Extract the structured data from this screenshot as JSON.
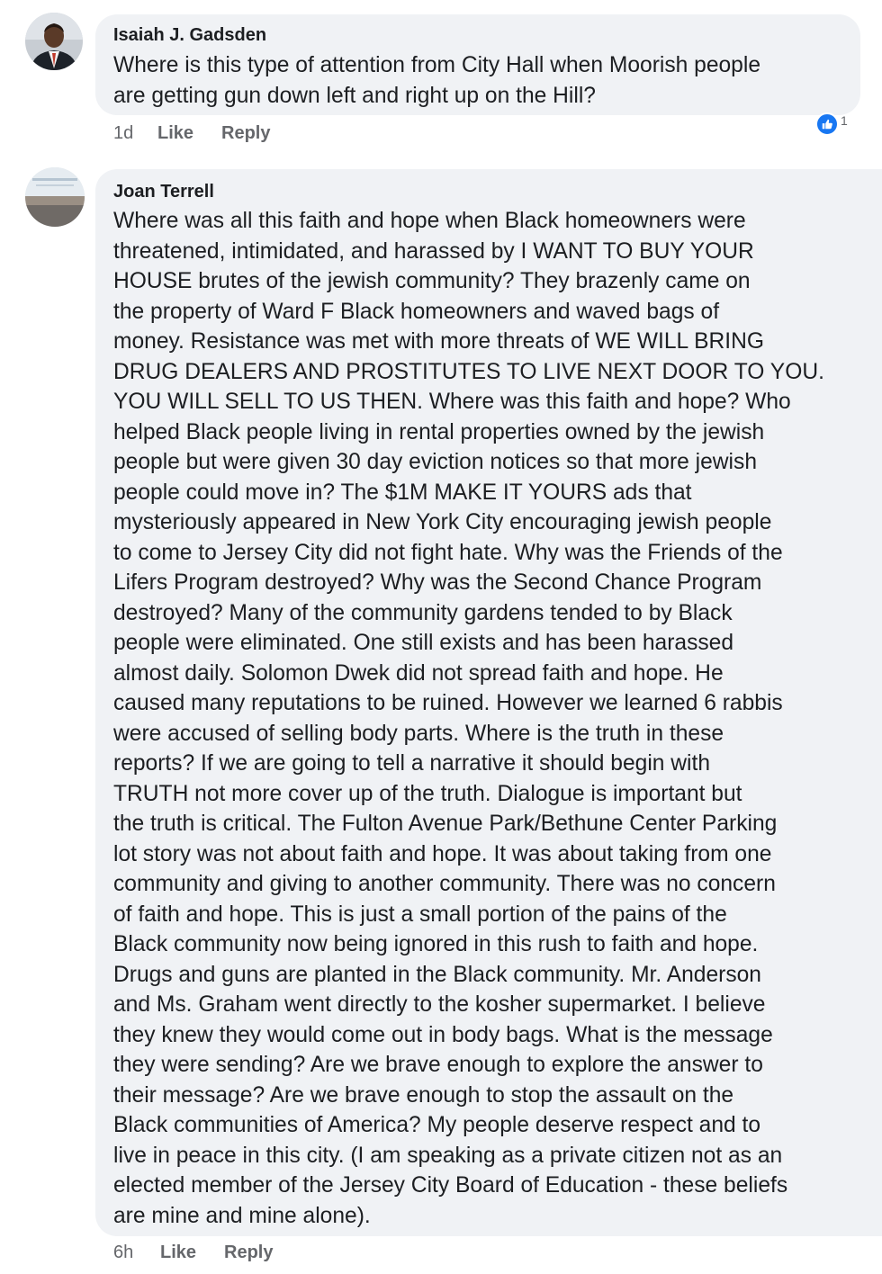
{
  "comments": [
    {
      "author": "Isaiah J. Gadsden",
      "text_lines": [
        "Where is this type of attention from City Hall when Moorish people",
        "are getting gun down left and right up on the Hill?"
      ],
      "time": "1d",
      "like_label": "Like",
      "reply_label": "Reply",
      "reaction_icon": "thumbs-up-icon",
      "reaction_count": "1"
    },
    {
      "author": "Joan Terrell",
      "text_lines": [
        "Where was all this faith and hope when Black homeowners were",
        "threatened, intimidated, and harassed by I WANT TO BUY YOUR",
        "HOUSE brutes of the jewish community?   They brazenly came on",
        "the property of Ward F Black homeowners and waved bags of",
        "money.  Resistance was met with more threats of WE WILL BRING",
        "DRUG DEALERS AND PROSTITUTES TO LIVE NEXT DOOR TO YOU.",
        "YOU WILL SELL TO US THEN.  Where was this faith and hope?   Who",
        "helped Black people living in rental properties owned by the jewish",
        "people but were given 30 day eviction notices so that more jewish",
        "people could move in?   The $1M MAKE IT YOURS ads that",
        "mysteriously appeared in New York City encouraging jewish people",
        "to come to Jersey City did not fight hate.  Why was the Friends of the",
        "Lifers Program destroyed?   Why was the Second Chance Program",
        "destroyed?  Many of the community gardens tended to by Black",
        "people were eliminated.  One still exists and has been harassed",
        "almost daily.  Solomon Dwek did not spread faith and hope.   He",
        "caused many reputations to be ruined.   However we learned 6 rabbis",
        "were accused of selling body parts.  Where is the truth in these",
        "reports?  If we are going to tell a narrative it should begin with",
        "TRUTH not more cover up of the truth.   Dialogue is important but",
        "the truth is critical.   The Fulton Avenue Park/Bethune Center Parking",
        "lot story was not about faith and hope.   It was about taking from one",
        "community and giving to another community.  There was no concern",
        "of faith and hope.   This is just a small portion of the pains of the",
        "Black community now being ignored in this rush to faith and hope.",
        "Drugs and guns are planted in the Black community.  Mr. Anderson",
        "and Ms. Graham went directly to the kosher supermarket.   I believe",
        "they knew they would come out in body bags.   What is the message",
        "they were sending?   Are we brave enough to explore the answer to",
        "their message?  Are we brave enough to stop the assault on the",
        "Black communities of America?  My people deserve respect and to",
        "live in peace in this city.  (I am speaking as a private citizen not as an",
        "elected member of the Jersey City Board of Education - these beliefs",
        "are mine and mine alone)."
      ],
      "time": "6h",
      "like_label": "Like",
      "reply_label": "Reply"
    }
  ],
  "colors": {
    "bubble_bg": "#f0f2f5",
    "meta_text": "#65676b",
    "reaction_blue": "#1877f2"
  }
}
